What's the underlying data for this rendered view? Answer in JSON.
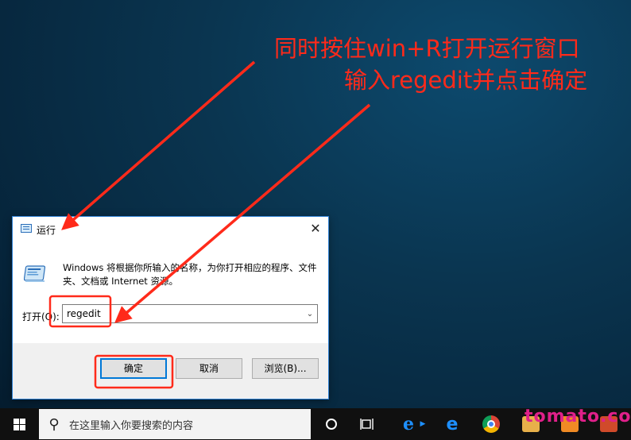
{
  "annotations": {
    "line1": "同时按住win+R打开运行窗口",
    "line2": "输入regedit并点击确定"
  },
  "colors": {
    "annotation": "#ff2a1a",
    "dialog_border": "#2d7fd3",
    "primary_button_border": "#0078d7",
    "watermark": "#e0208a"
  },
  "dialog": {
    "title": "运行",
    "close_glyph": "✕",
    "description": "Windows 将根据你所输入的名称，为你打开相应的程序、文件夹、文档或 Internet 资源。",
    "open_label": "打开(O):",
    "input_value": "regedit",
    "dropdown_glyph": "⌄",
    "buttons": {
      "ok": "确定",
      "cancel": "取消",
      "browse": "浏览(B)..."
    }
  },
  "taskbar": {
    "search_placeholder": "在这里输入你要搜索的内容",
    "icons": [
      "windows-start-icon",
      "search-icon",
      "cortana-icon",
      "task-view-icon",
      "internet-explorer-icon",
      "edge-icon",
      "chrome-icon",
      "app-icon",
      "app-icon",
      "app-icon"
    ]
  },
  "watermark": "tomato.com"
}
